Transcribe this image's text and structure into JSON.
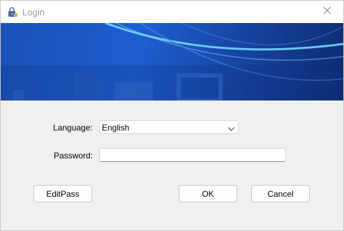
{
  "window": {
    "title": "Login",
    "title_icon": "padlock-icon",
    "close_icon": "close-icon"
  },
  "form": {
    "language_label": "Language:",
    "language_value": "English",
    "password_label": "Password:",
    "password_value": "",
    "password_placeholder": ""
  },
  "buttons": {
    "editpass_label": "EditPass",
    "ok_label": "OK",
    "cancel_label": "Cancel"
  },
  "colors": {
    "banner_blue": "#1e5fd0",
    "banner_dark": "#0e2b70",
    "dialog_bg": "#f0f0f0"
  }
}
